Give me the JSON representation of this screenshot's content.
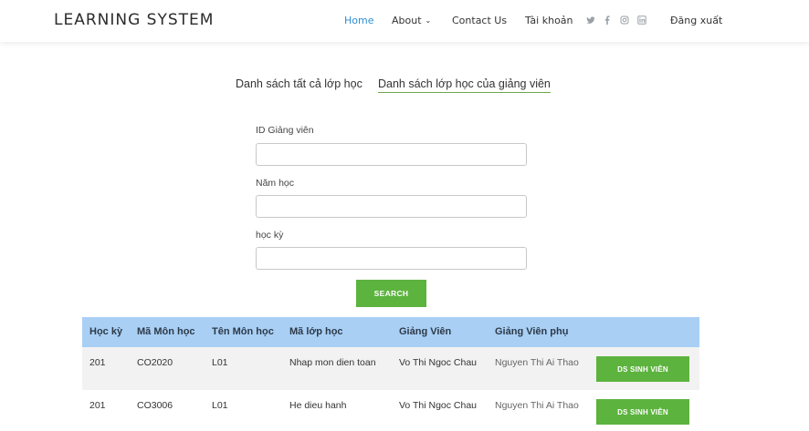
{
  "header": {
    "brand": "LEARNING SYSTEM",
    "nav": {
      "home": "Home",
      "about": "About",
      "contact": "Contact Us",
      "account": "Tài khoản",
      "logout": "Đăng xuất"
    },
    "social_icons": [
      "twitter-icon",
      "facebook-icon",
      "instagram-icon",
      "linkedin-icon"
    ],
    "active_color": "#2f8fd1"
  },
  "tabs": {
    "all_classes": "Danh sách tất cả lớp học",
    "lecturer_classes": "Danh sách lớp học của giảng viên",
    "selected": "lecturer_classes"
  },
  "form": {
    "lecturer_id_label": "ID Giảng viên",
    "lecturer_id_value": "",
    "year_label": "Năm học",
    "year_value": "",
    "semester_label": "học kỳ",
    "semester_value": "",
    "search_label": "SEARCH",
    "button_color": "#5cb33e"
  },
  "table": {
    "headers": {
      "semester": "Học kỳ",
      "course_code": "Mã Môn học",
      "course_name": "Tên Môn học",
      "class_code": "Mã lớp học",
      "lecturer": "Giảng Viên",
      "assistant": "Giảng Viên phụ"
    },
    "header_color": "#a9cff5",
    "rows": [
      {
        "semester": "201",
        "course_code": "CO2020",
        "course_name": "L01",
        "class_code": "Nhap mon dien toan",
        "lecturer": "Vo Thi Ngoc Chau",
        "assistant": "Nguyen Thi Ai Thao",
        "action": "DS SINH VIÊN"
      },
      {
        "semester": "201",
        "course_code": "CO3006",
        "course_name": "L01",
        "class_code": "He dieu hanh",
        "lecturer": "Vo Thi Ngoc Chau",
        "assistant": "Nguyen Thi Ai Thao",
        "action": "DS SINH VIÊN"
      }
    ]
  }
}
